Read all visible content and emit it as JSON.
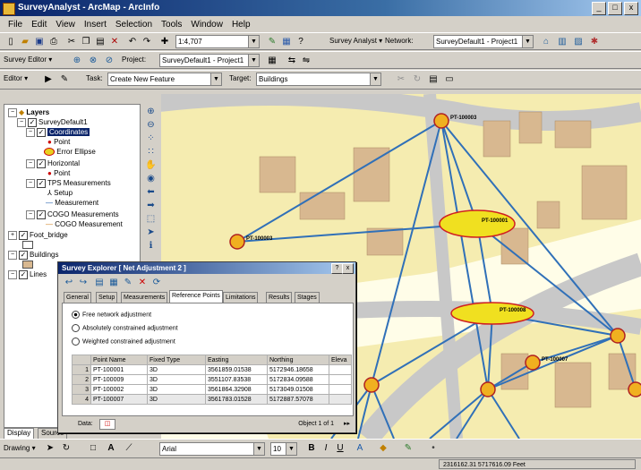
{
  "titlebar": {
    "title": "SurveyAnalyst - ArcMap - ArcInfo"
  },
  "menu": [
    "File",
    "Edit",
    "View",
    "Insert",
    "Selection",
    "Tools",
    "Window",
    "Help"
  ],
  "standard_toolbar": {
    "scale": "1:4,707"
  },
  "survey_toolbar": {
    "survey_analyst_label": "Survey Analyst ▾",
    "network_label": "Network:",
    "network_value": "SurveyDefault1 - Project1"
  },
  "survey_editor_toolbar": {
    "label": "Survey Editor ▾",
    "project_label": "Project:",
    "project_value": "SurveyDefault1 - Project1"
  },
  "editor_toolbar": {
    "label": "Editor ▾",
    "task_label": "Task:",
    "task_value": "Create New Feature",
    "target_label": "Target:",
    "target_value": "Buildings"
  },
  "toc": {
    "layers": "Layers",
    "items": [
      "SurveyDefault1",
      "Coordinates",
      "Point",
      "Error Ellipse",
      "Horizontal",
      "Point",
      "TPS Measurements",
      "Setup",
      "Measurement",
      "COGO Measurements",
      "COGO Measurement",
      "Foot_bridge",
      "Buildings",
      "Lines"
    ],
    "tabs": [
      "Display",
      "Source"
    ]
  },
  "dialog": {
    "title": "Survey Explorer [ Net Adjustment 2 ]",
    "close": "x",
    "tabs": [
      "General",
      "Setup",
      "Measurements",
      "Reference Points",
      "Limitations",
      "Results",
      "Stages"
    ],
    "active_tab": 3,
    "radios": [
      "Free network adjustment",
      "Absolutely constrained adjustment",
      "Weighted constrained adjustment"
    ],
    "columns": [
      "",
      "Point Name",
      "Fixed Type",
      "Easting",
      "Northing",
      "Eleva"
    ],
    "rows": [
      [
        "1",
        "PT-100001",
        "3D",
        "3561859.01538",
        "5172946.18658",
        ""
      ],
      [
        "2",
        "PT-100009",
        "3D",
        "3551107.83538",
        "5172834.09588",
        ""
      ],
      [
        "3",
        "PT-100002",
        "3D",
        "3561864.32908",
        "5173049.01508",
        ""
      ],
      [
        "4",
        "PT-100007",
        "3D",
        "3561783.01528",
        "5172887.57078",
        ""
      ]
    ],
    "footer_label": "Data:",
    "footer_right": "Object 1 of 1"
  },
  "map_labels": [
    "PT-100003",
    "PT-100003",
    "PT-100001",
    "PT-100008",
    "PT-100007"
  ],
  "drawing_toolbar": {
    "label": "Drawing ▾",
    "font": "Arial",
    "size": "10"
  },
  "status": {
    "coords": "2316162.31  5717616.09 Feet"
  }
}
